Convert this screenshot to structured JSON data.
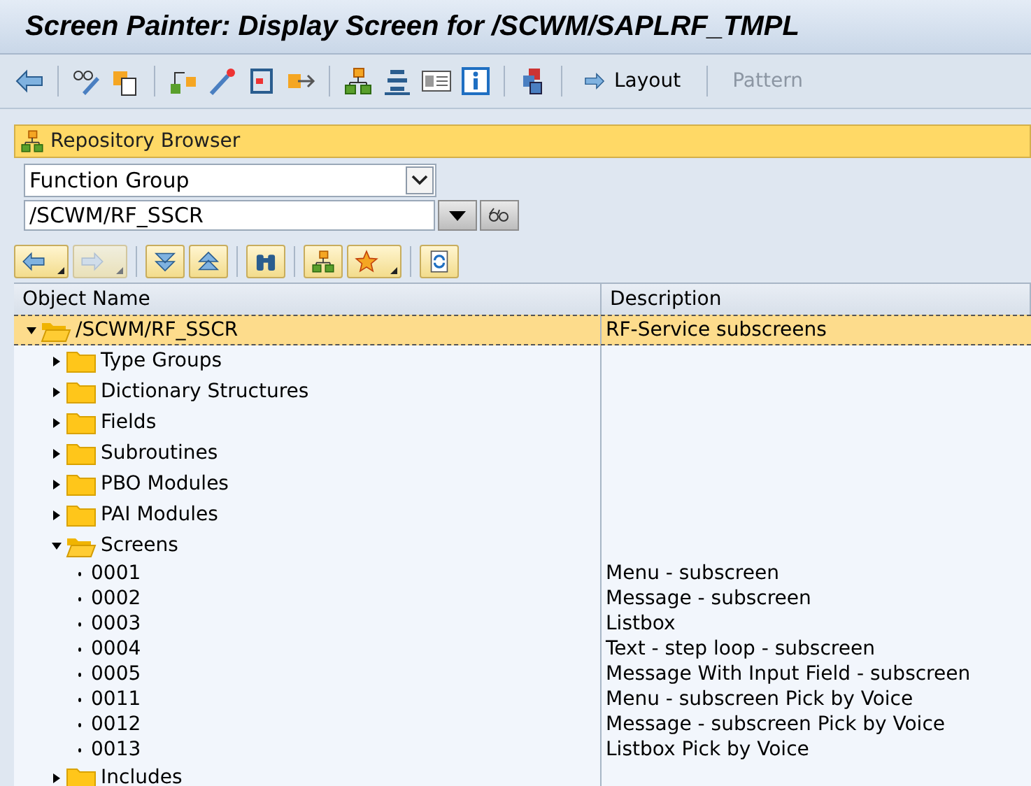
{
  "window": {
    "title": "Screen Painter: Display Screen for /SCWM/SAPLRF_TMPL"
  },
  "toolbar": {
    "buttons": [
      {
        "label": "Layout",
        "disabled": false
      },
      {
        "label": "Pattern",
        "disabled": true
      }
    ]
  },
  "repository_browser": {
    "title": "Repository Browser",
    "object_type": "Function Group",
    "object_name": "/SCWM/RF_SSCR"
  },
  "tree_toolbar": [
    {
      "kind": "back",
      "disabled": false,
      "menu": true
    },
    {
      "kind": "forward",
      "disabled": true,
      "menu": true
    },
    {
      "kind": "expand",
      "disabled": false,
      "menu": false
    },
    {
      "kind": "collapse",
      "disabled": false,
      "menu": false
    },
    {
      "kind": "find",
      "disabled": false,
      "menu": false
    },
    {
      "kind": "hierarchy",
      "disabled": false,
      "menu": false
    },
    {
      "kind": "favorites",
      "disabled": false,
      "menu": true
    },
    {
      "kind": "refresh",
      "disabled": false,
      "menu": false
    }
  ],
  "tree": {
    "columns": [
      "Object Name",
      "Description"
    ],
    "nodes": [
      {
        "kind": "folder",
        "name": "/SCWM/RF_SSCR",
        "description": "RF-Service subscreens",
        "expanded": true,
        "selected": true,
        "children": [
          {
            "kind": "folder",
            "name": "Type Groups",
            "expanded": false,
            "selected": false
          },
          {
            "kind": "folder",
            "name": "Dictionary Structures",
            "expanded": false,
            "selected": false
          },
          {
            "kind": "folder",
            "name": "Fields",
            "expanded": false,
            "selected": false
          },
          {
            "kind": "folder",
            "name": "Subroutines",
            "expanded": false,
            "selected": false
          },
          {
            "kind": "folder",
            "name": "PBO Modules",
            "expanded": false,
            "selected": false
          },
          {
            "kind": "folder",
            "name": "PAI Modules",
            "expanded": false,
            "selected": false
          },
          {
            "kind": "folder",
            "name": "Screens",
            "expanded": true,
            "selected": false,
            "children": [
              {
                "kind": "leaf",
                "name": "0001",
                "description": "Menu - subscreen",
                "selected": false
              },
              {
                "kind": "leaf",
                "name": "0002",
                "description": "Message - subscreen",
                "selected": false
              },
              {
                "kind": "leaf",
                "name": "0003",
                "description": "Listbox",
                "selected": false
              },
              {
                "kind": "leaf",
                "name": "0004",
                "description": "Text - step loop - subscreen",
                "selected": false
              },
              {
                "kind": "leaf",
                "name": "0005",
                "description": "Message With Input Field - subscreen",
                "selected": false
              },
              {
                "kind": "leaf",
                "name": "0011",
                "description": "Menu - subscreen Pick by Voice",
                "selected": false
              },
              {
                "kind": "leaf",
                "name": "0012",
                "description": "Message - subscreen Pick by Voice",
                "selected": false
              },
              {
                "kind": "leaf",
                "name": "0013",
                "description": "Listbox Pick by Voice",
                "selected": false
              }
            ]
          },
          {
            "kind": "folder",
            "name": "Includes",
            "expanded": false,
            "selected": false
          }
        ]
      }
    ]
  }
}
